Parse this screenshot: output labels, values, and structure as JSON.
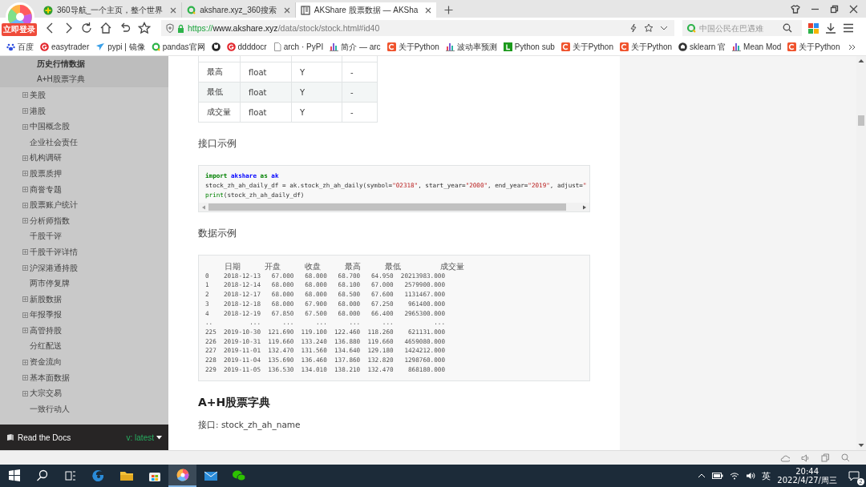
{
  "browser": {
    "tabs": [
      {
        "title": "360导航_一个主页，整个世界",
        "kind": "plus-ball",
        "selected": false
      },
      {
        "title": "akshare.xyz_360搜索",
        "kind": "ring",
        "selected": false
      },
      {
        "title": "AKShare 股票数据 — AKSha",
        "kind": "book",
        "selected": true
      }
    ],
    "login_badge": "立即登录",
    "url": {
      "scheme": "https://",
      "host": "www.akshare.xyz",
      "path": "/data/stock/stock.html#id40"
    },
    "search": {
      "placeholder": "中国公民在巴遇难"
    },
    "bookmarks": [
      {
        "label": "百度",
        "kind": "paw"
      },
      {
        "label": "easytrader",
        "kind": "g-logo"
      },
      {
        "label": "pypi | 镜像",
        "kind": "bird"
      },
      {
        "label": "pandas官网",
        "kind": "ring"
      },
      {
        "kind": "cat"
      },
      {
        "label": "ddddocr",
        "kind": "g-logo"
      },
      {
        "label": "arch · PyPI",
        "kind": "page"
      },
      {
        "label": "简介 — arc",
        "kind": "bars"
      },
      {
        "label": "关于Python",
        "kind": "c-logo"
      },
      {
        "label": "波动率预测",
        "kind": "bars"
      },
      {
        "label": "Python sub",
        "kind": "l-logo"
      },
      {
        "label": "关于Python",
        "kind": "c-logo"
      },
      {
        "label": "关于Python",
        "kind": "c-logo"
      },
      {
        "label": "sklearn 官",
        "kind": "dark-logo"
      },
      {
        "label": "Mean Mod",
        "kind": "bars"
      },
      {
        "label": "关于Python",
        "kind": "c-logo"
      }
    ]
  },
  "sidebar": {
    "items": [
      {
        "label": "历史行情数据",
        "kind": "subitem",
        "selected": true,
        "expandable": false
      },
      {
        "label": "A+H股票字典",
        "kind": "subitem",
        "selected": false,
        "expandable": false
      },
      {
        "label": "美股",
        "kind": "item",
        "selected": false,
        "expandable": true
      },
      {
        "label": "港股",
        "kind": "item",
        "selected": false,
        "expandable": true
      },
      {
        "label": "中国概念股",
        "kind": "item",
        "selected": false,
        "expandable": true
      },
      {
        "label": "企业社会责任",
        "kind": "item",
        "selected": false,
        "expandable": false
      },
      {
        "label": "机构调研",
        "kind": "item",
        "selected": false,
        "expandable": true
      },
      {
        "label": "股票质押",
        "kind": "item",
        "selected": false,
        "expandable": true
      },
      {
        "label": "商誉专题",
        "kind": "item",
        "selected": false,
        "expandable": true
      },
      {
        "label": "股票账户统计",
        "kind": "item",
        "selected": false,
        "expandable": true
      },
      {
        "label": "分析师指数",
        "kind": "item",
        "selected": false,
        "expandable": true
      },
      {
        "label": "千股千评",
        "kind": "item",
        "selected": false,
        "expandable": false
      },
      {
        "label": "千股千评详情",
        "kind": "item",
        "selected": false,
        "expandable": true
      },
      {
        "label": "沪深港通持股",
        "kind": "item",
        "selected": false,
        "expandable": true
      },
      {
        "label": "两市停复牌",
        "kind": "item",
        "selected": false,
        "expandable": false
      },
      {
        "label": "新股数据",
        "kind": "item",
        "selected": false,
        "expandable": true
      },
      {
        "label": "年报季报",
        "kind": "item",
        "selected": false,
        "expandable": true
      },
      {
        "label": "高管持股",
        "kind": "item",
        "selected": false,
        "expandable": true
      },
      {
        "label": "分红配送",
        "kind": "item",
        "selected": false,
        "expandable": false
      },
      {
        "label": "资金流向",
        "kind": "item",
        "selected": false,
        "expandable": true
      },
      {
        "label": "基本面数据",
        "kind": "item",
        "selected": false,
        "expandable": true
      },
      {
        "label": "大宗交易",
        "kind": "item",
        "selected": false,
        "expandable": true
      },
      {
        "label": "一致行动人",
        "kind": "item",
        "selected": false,
        "expandable": false
      }
    ],
    "footer": {
      "brand": "Read the Docs",
      "version": "v: latest"
    }
  },
  "content": {
    "param_table": {
      "rows": [
        [
          "最高",
          "float",
          "Y",
          "-"
        ],
        [
          "最低",
          "float",
          "Y",
          "-"
        ],
        [
          "成交量",
          "float",
          "Y",
          "-"
        ]
      ]
    },
    "example_heading": "接口示例",
    "code_lines": [
      [
        {
          "text": "import",
          "kind": "keyword"
        },
        {
          "text": " akshare",
          "kind": "name"
        },
        {
          "text": " as",
          "kind": "keyword"
        },
        {
          "text": " ak",
          "kind": "name"
        }
      ],
      [
        {
          "text": "stock_zh_ah_daily_df = ak.stock_zh_ah_daily(symbol=",
          "kind": "plain"
        },
        {
          "text": "\"02318\"",
          "kind": "string"
        },
        {
          "text": ", start_year=",
          "kind": "plain"
        },
        {
          "text": "\"2000\"",
          "kind": "string"
        },
        {
          "text": ", end_year=",
          "kind": "plain"
        },
        {
          "text": "\"2019\"",
          "kind": "string"
        },
        {
          "text": ", adjust=",
          "kind": "plain"
        },
        {
          "text": "\"",
          "kind": "string"
        }
      ],
      [
        {
          "text": "print",
          "kind": "builtin"
        },
        {
          "text": "(stock_zh_ah_daily_df)",
          "kind": "plain"
        }
      ]
    ],
    "output_heading": "数据示例",
    "output_lines": [
      "    日期     开盘     收盘     最高     最低        成交量",
      "0    2018-12-13   67.000   68.000   68.700   64.950  20213983.000",
      "1    2018-12-14   68.000   68.000   68.100   67.000   2579900.000",
      "2    2018-12-17   68.000   68.000   68.500   67.600   1131467.000",
      "3    2018-12-18   68.000   67.900   68.000   67.250    961400.000",
      "4    2018-12-19   67.850   67.500   68.000   66.400   2965300.000",
      "..          ...      ...      ...      ...      ...           ...",
      "225  2019-10-30  121.690  119.100  122.460  118.260    621131.000",
      "226  2019-10-31  119.660  133.240  136.880  119.660   4659080.000",
      "227  2019-11-01  132.470  131.560  134.640  129.180   1424212.000",
      "228  2019-11-04  135.690  136.460  137.860  132.820   1298760.000",
      "229  2019-11-05  136.530  134.010  138.210  132.470    868180.000"
    ],
    "section_title": "A+H股票字典",
    "interface_text": "接口: stock_zh_ah_name"
  },
  "taskbar": {
    "apps": [
      {
        "kind": "start",
        "active": false
      },
      {
        "kind": "search",
        "active": false
      },
      {
        "kind": "taskview",
        "active": false
      },
      {
        "kind": "edge",
        "active": false
      },
      {
        "kind": "folder",
        "active": false
      },
      {
        "kind": "store",
        "active": false
      },
      {
        "kind": "browser",
        "active": true
      },
      {
        "kind": "mail",
        "active": false
      },
      {
        "kind": "chat",
        "active": false
      }
    ],
    "ime": "英",
    "time": "20:44",
    "date": "2022/4/27/周三",
    "notifications": "2"
  }
}
